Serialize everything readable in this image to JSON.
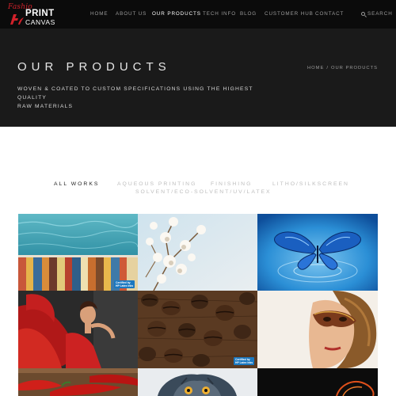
{
  "brand": {
    "script": "Fashio",
    "print": "PRINT",
    "canvas": "CANVAS",
    "color_red": "#d0212a"
  },
  "nav": {
    "items": [
      {
        "label": "HOME",
        "active": false
      },
      {
        "label": "ABOUT US",
        "active": false
      },
      {
        "label": "OUR PRODUCTS",
        "active": true
      },
      {
        "label": "TECH INFO",
        "active": false
      },
      {
        "label": "BLOG",
        "active": false
      },
      {
        "label": "CUSTOMER HUB",
        "active": false
      },
      {
        "label": "CONTACT",
        "active": false
      }
    ],
    "search_label": "SEARCH",
    "search_icon": "search-icon"
  },
  "hero": {
    "title": "OUR PRODUCTS",
    "subtitle_line1": "WOVEN & COATED TO CUSTOM SPECIFICATIONS USING THE HIGHEST QUALITY",
    "subtitle_line2": "RAW MATERIALS",
    "breadcrumb": {
      "home": "HOME",
      "separator": "/",
      "current": "OUR PRODUCTS"
    }
  },
  "filters": [
    {
      "label": "ALL WORKS",
      "active": true
    },
    {
      "label": "AQUEOUS PRINTING",
      "active": false
    },
    {
      "label": "FINISHING",
      "active": false
    },
    {
      "label": "LITHO/SILKSCREEN",
      "active": false
    },
    {
      "label": "SOLVENT/ECO-SOLVENT/UV/LATEX",
      "active": false
    }
  ],
  "grid": {
    "tiles": [
      {
        "subject": "pool-water-and-striped-deck"
      },
      {
        "subject": "cotton-branches"
      },
      {
        "subject": "blue-butterfly-water-splash"
      },
      {
        "subject": "woman-in-red-dress"
      },
      {
        "subject": "coffee-beans-on-wood"
      },
      {
        "subject": "woman-with-masquerade-mask"
      },
      {
        "subject": "red-chili-peppers"
      },
      {
        "subject": "owl"
      },
      {
        "subject": "dark-abstract"
      }
    ],
    "badge_line1": "Certified by",
    "badge_line2": "HP Latex Inks"
  },
  "colors": {
    "nav_bg": "#0b0b0b",
    "hero_bg": "#1a1a1a",
    "badge_blue": "#1b78c0"
  }
}
